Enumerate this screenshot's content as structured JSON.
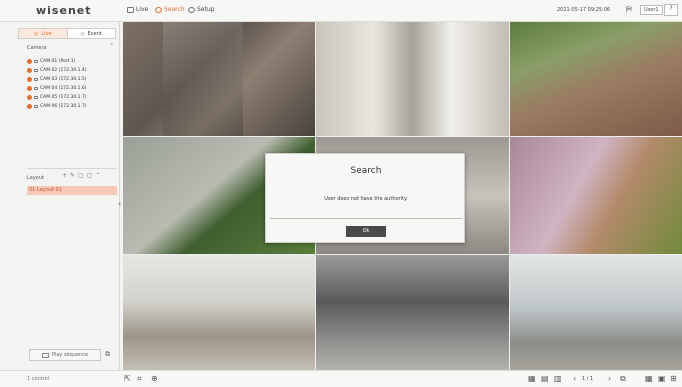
{
  "app": {
    "logo": "wisenet"
  },
  "topbar": {
    "menu": [
      {
        "label": "Live"
      },
      {
        "label": "Search"
      },
      {
        "label": "Setup"
      }
    ],
    "datetime": "2021-05-17 09:25:06",
    "user": "User1"
  },
  "sidebar": {
    "tabs": [
      {
        "label": "Live"
      },
      {
        "label": "Event"
      }
    ],
    "camera_title": "Camera",
    "cameras": [
      {
        "label": "CAM 01 (Port 1)"
      },
      {
        "label": "CAM 02 (172.30.1.4)"
      },
      {
        "label": "CAM 03 (172.30.1.5)"
      },
      {
        "label": "CAM 04 (172.30.1.6)"
      },
      {
        "label": "CAM 05 (172.30.1.7)"
      },
      {
        "label": "CAM 06 (172.30.1.7)"
      }
    ],
    "layout_title": "Layout",
    "layout_item": "01 Layout 01",
    "play_button": "Play sequence",
    "status": "1 control"
  },
  "dialog": {
    "title": "Search",
    "message": "User does not have the authority.",
    "ok": "Ok"
  },
  "bottombar": {
    "pager": "1 / 1"
  }
}
